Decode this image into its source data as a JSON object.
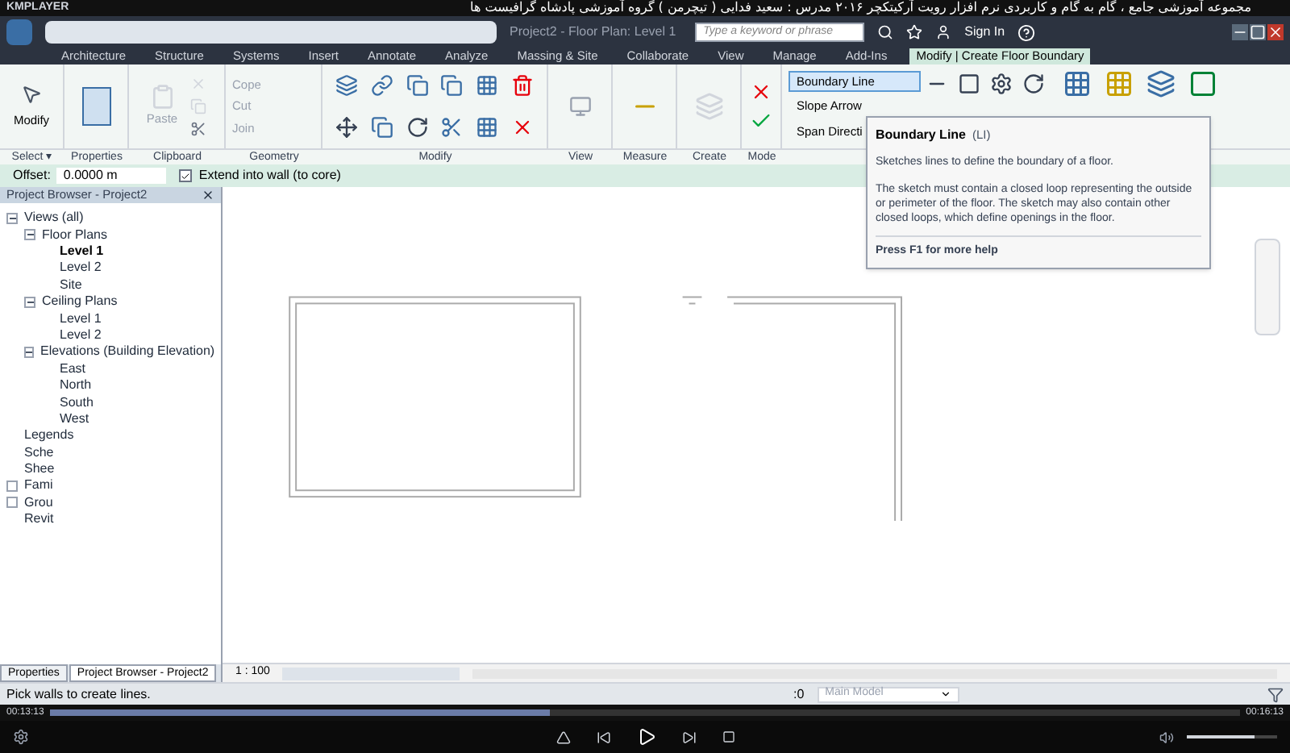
{
  "player": {
    "app_name": "KMPLAYER",
    "title": "مجموعه آموزشی جامع ، گام به گام و کاربردی نرم افزار رویت آرکیتکچر ۲۰۱۶   مدرس : سعید فدایی ( تیچرمن ) گروه آموزشی پادشاه گرافیست ها",
    "time_elapsed": "00:13:13",
    "time_total": "00:16:13",
    "level": 0.42,
    "volume": {
      "level": 0.75
    }
  },
  "revit": {
    "window_title": "Project2 - Floor Plan: Level 1",
    "search": {
      "placeholder": "Type a keyword or phrase"
    },
    "sign_in": "Sign In",
    "tabs": [
      {
        "label": "Architecture",
        "selected": false
      },
      {
        "label": "Structure",
        "selected": false
      },
      {
        "label": "Systems",
        "selected": false
      },
      {
        "label": "Insert",
        "selected": false
      },
      {
        "label": "Annotate",
        "selected": false
      },
      {
        "label": "Analyze",
        "selected": false
      },
      {
        "label": "Massing & Site",
        "selected": false
      },
      {
        "label": "Collaborate",
        "selected": false
      },
      {
        "label": "View",
        "selected": false
      },
      {
        "label": "Manage",
        "selected": false
      },
      {
        "label": "Add-Ins",
        "selected": false
      },
      {
        "label": "Modify | Create Floor Boundary",
        "selected": true
      }
    ],
    "ribbon": {
      "modify_button": "Modify",
      "paste_button": {
        "label": "Paste",
        "disabled": true
      },
      "geometry_buttons": [
        {
          "label": "Cope",
          "disabled": true
        },
        {
          "label": "Cut",
          "disabled": true
        },
        {
          "label": "Join",
          "disabled": true
        }
      ],
      "draw_buttons": [
        {
          "label": "Boundary Line",
          "selected": true
        },
        {
          "label": "Slope Arrow",
          "selected": false
        },
        {
          "label": "Span Directi",
          "selected": false
        }
      ],
      "panels": [
        {
          "label": "Select ▾"
        },
        {
          "label": "Properties"
        },
        {
          "label": "Clipboard"
        },
        {
          "label": "Geometry"
        },
        {
          "label": "Modify"
        },
        {
          "label": "View"
        },
        {
          "label": "Measure"
        },
        {
          "label": "Create"
        },
        {
          "label": "Mode"
        }
      ]
    },
    "options_bar": {
      "offset_label": "Offset:",
      "offset_value": "0.0000 m",
      "extend": {
        "label": "Extend into wall (to core)",
        "checked": true
      }
    },
    "tooltip": {
      "title": "Boundary Line",
      "shortcut": "(LI)",
      "summary": "Sketches lines to define the boundary of a floor.",
      "detail": "The sketch must contain a closed loop representing the outside or perimeter of the floor. The sketch may also contain other closed loops, which define openings in the floor.",
      "help": "Press F1 for more help"
    },
    "project_browser": {
      "title": "Project Browser - Project2",
      "tree": [
        {
          "label": "Views (all)",
          "expanded": true,
          "children": [
            {
              "label": "Floor Plans",
              "expanded": true,
              "children": [
                {
                  "label": "Level 1",
                  "selected": true
                },
                {
                  "label": "Level 2",
                  "selected": false
                },
                {
                  "label": "Site",
                  "selected": false
                }
              ]
            },
            {
              "label": "Ceiling Plans",
              "expanded": true,
              "children": [
                {
                  "label": "Level 1",
                  "selected": false
                },
                {
                  "label": "Level 2",
                  "selected": false
                }
              ]
            },
            {
              "label": "Elevations (Building Elevation)",
              "expanded": true,
              "children": [
                {
                  "label": "East",
                  "selected": false
                },
                {
                  "label": "North",
                  "selected": false
                },
                {
                  "label": "South",
                  "selected": false
                },
                {
                  "label": "West",
                  "selected": false
                }
              ]
            }
          ]
        },
        {
          "label": "Legends"
        },
        {
          "label": "Sche"
        },
        {
          "label": "Shee"
        },
        {
          "label": "Fami",
          "expanded": false
        },
        {
          "label": "Grou",
          "expanded": false
        },
        {
          "label": "Revit"
        }
      ]
    },
    "bottom_tabs": [
      {
        "label": "Properties",
        "selected": false
      },
      {
        "label": "Project Browser - Project2",
        "selected": true
      }
    ],
    "scale": "1 : 100",
    "status_bar": {
      "text": "Pick walls to create lines.",
      "count": ":0",
      "model": "Main Model"
    }
  }
}
